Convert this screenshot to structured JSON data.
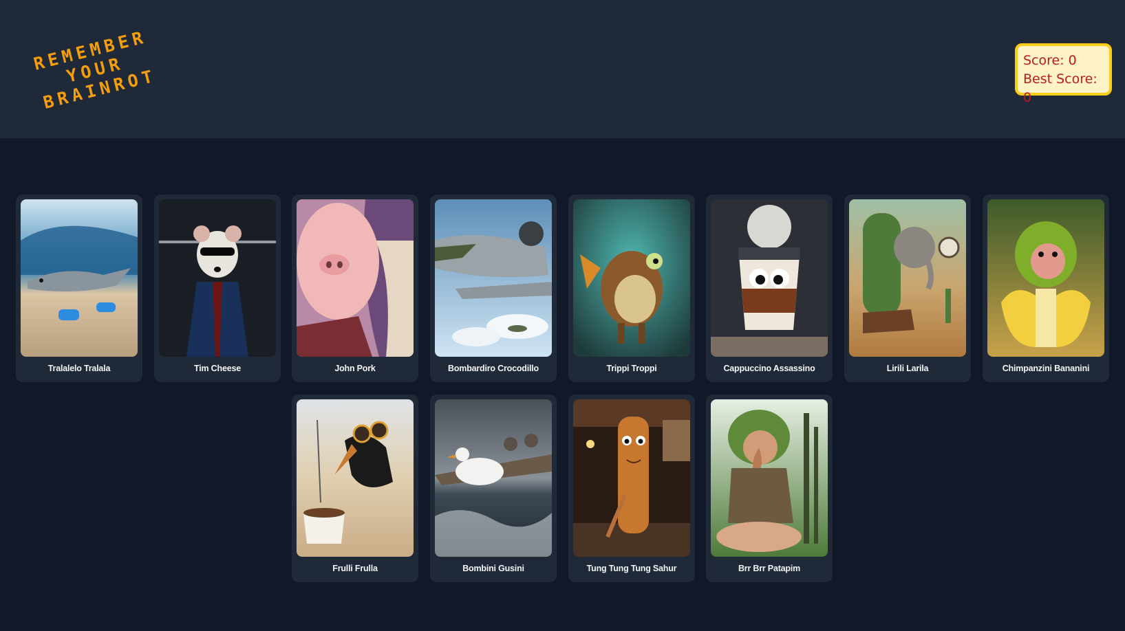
{
  "header": {
    "logo_lines": [
      "REMEMBER",
      "YOUR",
      "BRAINROT"
    ],
    "score_text": "Score: 0",
    "best_score_text": "Best Score: 0"
  },
  "cards": [
    {
      "name": "Tralalelo Tralala"
    },
    {
      "name": "Tim Cheese"
    },
    {
      "name": "John Pork"
    },
    {
      "name": "Bombardiro Crocodillo"
    },
    {
      "name": "Trippi Troppi"
    },
    {
      "name": "Cappuccino Assassino"
    },
    {
      "name": "Lirili Larila"
    },
    {
      "name": "Chimpanzini Bananini"
    },
    {
      "name": "Frulli Frulla"
    },
    {
      "name": "Bombini Gusini"
    },
    {
      "name": "Tung Tung Tung Sahur"
    },
    {
      "name": "Brr Brr Patapim"
    }
  ],
  "colors": {
    "page_bg": "#111827",
    "header_bg": "#1f2937",
    "card_bg": "#1f2937",
    "logo": "#f59e0b",
    "score_bg": "#fef3c7",
    "score_border": "#facc15",
    "score_text": "#b91c1c"
  }
}
